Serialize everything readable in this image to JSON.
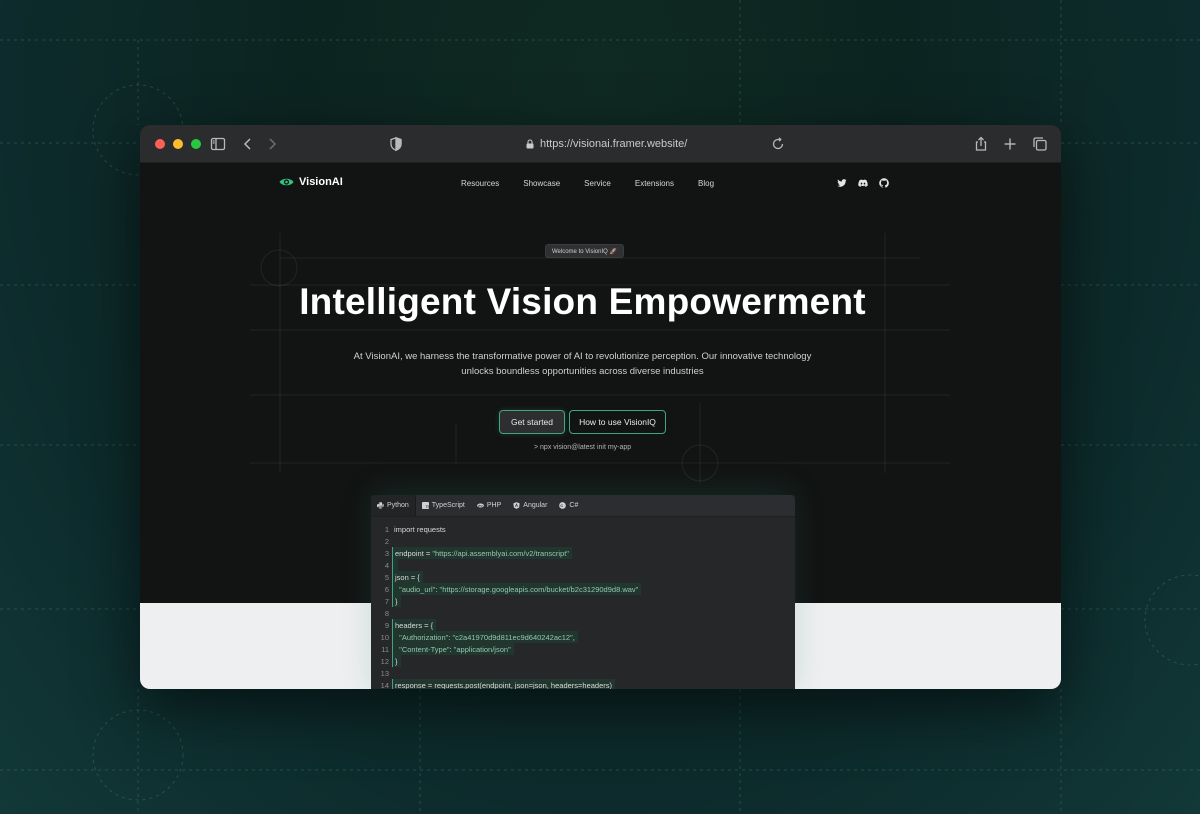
{
  "browser": {
    "url": "https://visionai.framer.website/",
    "icons": [
      "sidebar-icon",
      "back-icon",
      "forward-icon",
      "shield-icon",
      "lock-icon",
      "reload-icon",
      "share-icon",
      "new-tab-icon",
      "tabs-overview-icon"
    ]
  },
  "site": {
    "logo_text": "VisionAI",
    "nav": [
      "Resources",
      "Showcase",
      "Service",
      "Extensions",
      "Blog"
    ],
    "socials": [
      "twitter-icon",
      "discord-icon",
      "github-icon"
    ],
    "badge": "Welcome to VisionIQ 🚀",
    "title": "Intelligent Vision Empowerment",
    "subtitle_line1": "At VisionAI, we harness the transformative power of AI to revolutionize perception. Our innovative technology",
    "subtitle_line2": "unlocks boundless opportunities across diverse industries",
    "primary_cta": "Get started",
    "secondary_cta": "How to use VisionIQ",
    "npx_command": "> npx vision@latest init my-app"
  },
  "code_panel": {
    "tabs": [
      "Python",
      "TypeScript",
      "PHP",
      "Angular",
      "C#"
    ],
    "active_tab": "Python",
    "lines": [
      {
        "n": "1",
        "text": "import requests",
        "hl": false
      },
      {
        "n": "2",
        "text": "",
        "hl": false
      },
      {
        "n": "3",
        "text": "endpoint = \"https://api.assemblyai.com/v2/transcript\"",
        "hl": true
      },
      {
        "n": "4",
        "text": "",
        "hl": true
      },
      {
        "n": "5",
        "text": "json = {",
        "hl": true
      },
      {
        "n": "6",
        "text": "  \"audio_url\": \"https://storage.googleapis.com/bucket/b2c31290d9d8.wav\"",
        "hl": true
      },
      {
        "n": "7",
        "text": "}",
        "hl": true
      },
      {
        "n": "8",
        "text": "",
        "hl": false
      },
      {
        "n": "9",
        "text": "headers = {",
        "hl": true
      },
      {
        "n": "10",
        "text": "  \"Authorization\": \"c2a41970d9d811ec9d640242ac12\",",
        "hl": true
      },
      {
        "n": "11",
        "text": "  \"Content-Type\": \"application/json\"",
        "hl": true
      },
      {
        "n": "12",
        "text": "}",
        "hl": true
      },
      {
        "n": "13",
        "text": "",
        "hl": false
      },
      {
        "n": "14",
        "text": "response = requests.post(endpoint, json=json, headers=headers)",
        "hl": true
      }
    ]
  },
  "colors": {
    "accent": "#3fa57e",
    "traffic_red": "#fe5f57",
    "traffic_yellow": "#febc2e",
    "traffic_green": "#28c840"
  }
}
